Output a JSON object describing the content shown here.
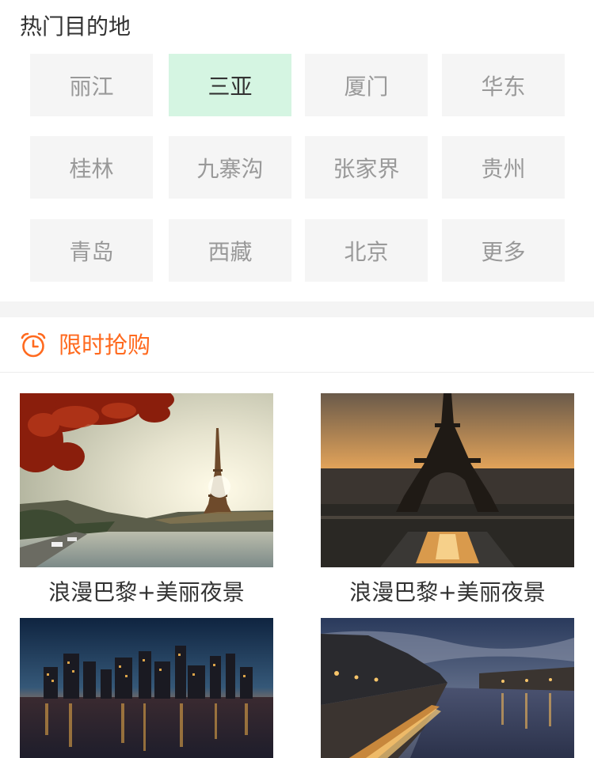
{
  "hot_destinations": {
    "title": "热门目的地",
    "items": [
      {
        "label": "丽江",
        "active": false
      },
      {
        "label": "三亚",
        "active": true
      },
      {
        "label": "厦门",
        "active": false
      },
      {
        "label": "华东",
        "active": false
      },
      {
        "label": "桂林",
        "active": false
      },
      {
        "label": "九寨沟",
        "active": false
      },
      {
        "label": "张家界",
        "active": false
      },
      {
        "label": "贵州",
        "active": false
      },
      {
        "label": "青岛",
        "active": false
      },
      {
        "label": "西藏",
        "active": false
      },
      {
        "label": "北京",
        "active": false
      },
      {
        "label": "更多",
        "active": false
      }
    ]
  },
  "flash_sale": {
    "icon": "alarm-clock-icon",
    "title": "限时抢购",
    "accent_color": "#ff6a1f",
    "cards": [
      {
        "caption": "浪漫巴黎+美丽夜景",
        "image": "eiffel-tower-autumn-photo"
      },
      {
        "caption": "浪漫巴黎+美丽夜景",
        "image": "eiffel-tower-sunset-photo"
      },
      {
        "caption": "",
        "image": "city-skyline-night-photo"
      },
      {
        "caption": "",
        "image": "paris-river-night-photo"
      }
    ]
  }
}
